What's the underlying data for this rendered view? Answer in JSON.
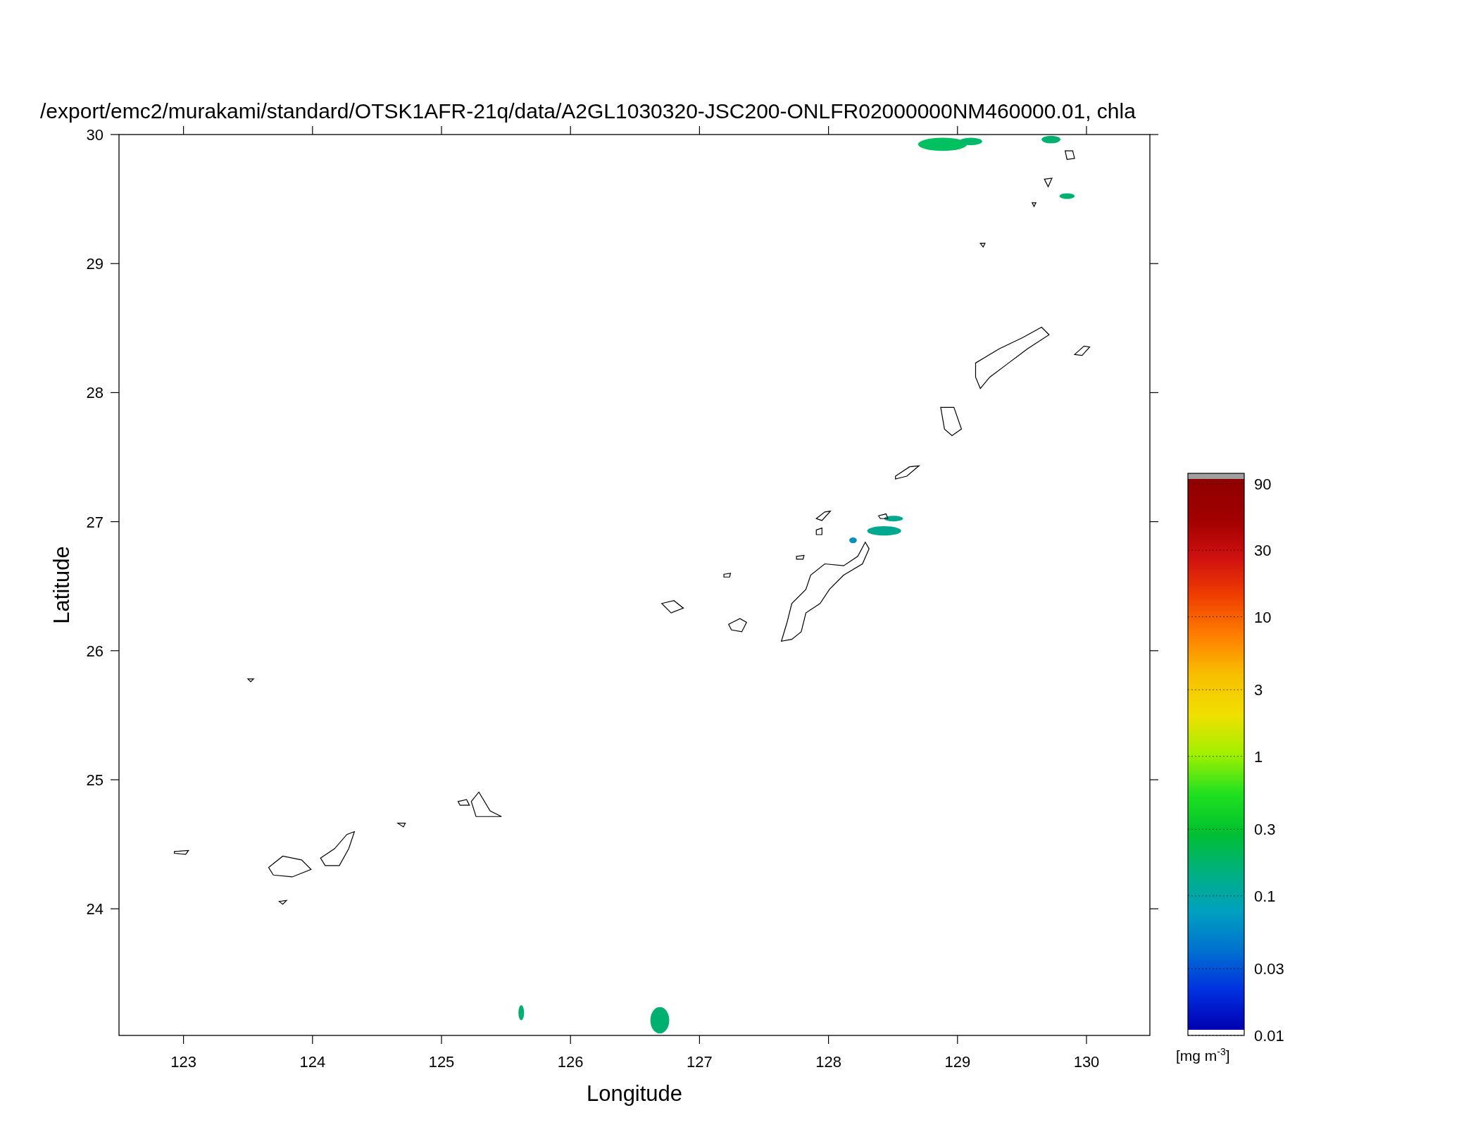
{
  "title": "/export/emc2/murakami/standard/OTSK1AFR-21q/data/A2GL1030320-JSC200-ONLFR02000000NM460000.01, chla",
  "x_axis": {
    "label": "Longitude",
    "ticks": [
      "123",
      "124",
      "125",
      "126",
      "127",
      "128",
      "129",
      "130"
    ]
  },
  "y_axis": {
    "label": "Latitude",
    "ticks": [
      "30",
      "29",
      "28",
      "27",
      "26",
      "25",
      "24"
    ]
  },
  "colorbar": {
    "labels": [
      "90",
      "30",
      "10",
      "3",
      "1",
      "0.3",
      "0.1",
      "0.03",
      "0.01"
    ],
    "unit": "[mg m$^{-3}$]"
  }
}
